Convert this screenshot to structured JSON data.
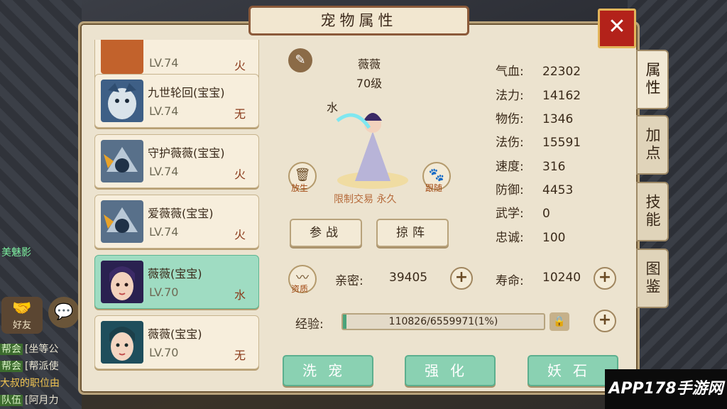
{
  "title": "宠物属性",
  "close_label": "✕",
  "colors": {
    "accent": "#b3221a",
    "selected": "#9fdcc2",
    "panel": "#ece3cf"
  },
  "pets": [
    {
      "name": "",
      "level": "LV.74",
      "element": "火",
      "selected": false
    },
    {
      "name": "九世轮回(宝宝)",
      "level": "LV.74",
      "element": "无",
      "selected": false
    },
    {
      "name": "守护薇薇(宝宝)",
      "level": "LV.74",
      "element": "火",
      "selected": false
    },
    {
      "name": "爱薇薇(宝宝)",
      "level": "LV.74",
      "element": "火",
      "selected": false
    },
    {
      "name": "薇薇(宝宝)",
      "level": "LV.70",
      "element": "水",
      "selected": true
    },
    {
      "name": "薇薇(宝宝)",
      "level": "LV.70",
      "element": "无",
      "selected": false
    }
  ],
  "tabs": [
    {
      "label": "属性",
      "active": true
    },
    {
      "label": "加点",
      "active": false
    },
    {
      "label": "技能",
      "active": false
    },
    {
      "label": "图鉴",
      "active": false
    }
  ],
  "detail": {
    "pet_name": "薇薇",
    "pet_level": "70级",
    "element": "水",
    "release_label": "放生",
    "follow_label": "跟随",
    "restriction": "限制交易 永久",
    "battle_btn": "参战",
    "formation_btn": "掠阵",
    "aptitude_label": "资质"
  },
  "stats": [
    {
      "label": "气血:",
      "value": "22302"
    },
    {
      "label": "法力:",
      "value": "14162"
    },
    {
      "label": "物伤:",
      "value": "1346"
    },
    {
      "label": "法伤:",
      "value": "15591"
    },
    {
      "label": "速度:",
      "value": "316"
    },
    {
      "label": "防御:",
      "value": "4453"
    },
    {
      "label": "武学:",
      "value": "0"
    },
    {
      "label": "忠诚:",
      "value": "100"
    }
  ],
  "intimacy": {
    "label": "亲密:",
    "value": "39405"
  },
  "lifespan": {
    "label": "寿命:",
    "value": "10240"
  },
  "experience": {
    "label": "经验:",
    "text": "110826/6559971(1%)",
    "fraction": 0.017
  },
  "actions": {
    "wash": "洗宠",
    "strengthen": "强化",
    "demon_stone": "妖石"
  },
  "left_ui": {
    "friend_label": "好友",
    "side_name": "美魅影",
    "chat": [
      {
        "tag": "帮会",
        "text": "[坐等公"
      },
      {
        "tag": "帮会",
        "text": "[帮派使"
      },
      {
        "tag": "",
        "text": "大叔的职位由"
      },
      {
        "tag": "队伍",
        "text": "[阿月力"
      }
    ]
  },
  "watermark": "APP178手游网"
}
